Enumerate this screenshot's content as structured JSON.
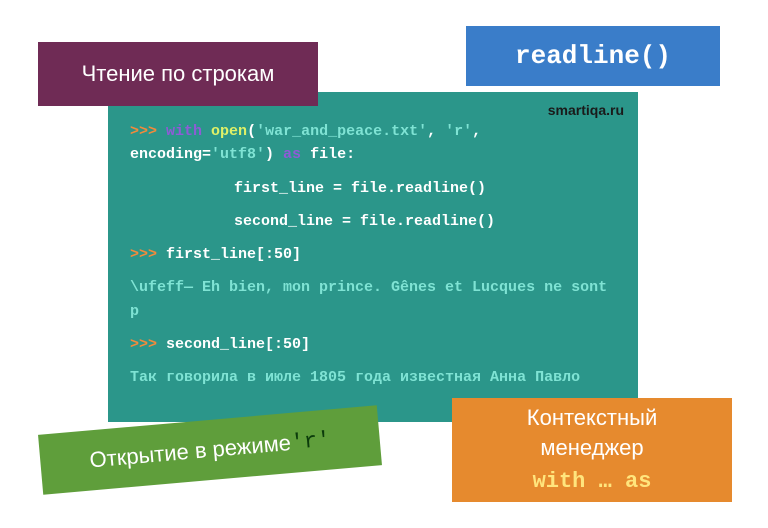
{
  "site": "smartiqa.ru",
  "labels": {
    "purple": "Чтение по строкам",
    "blue": "readline()",
    "green_text": "Открытие в режиме ",
    "green_code": "'r'",
    "orange_l1": "Контекстный",
    "orange_l2": "менеджер",
    "orange_code": "with … as"
  },
  "code": {
    "prompt": ">>> ",
    "kw_with": "with",
    "fn_open": "open",
    "paren_open": "(",
    "str_file": "'war_and_peace.txt'",
    "comma1": ", ",
    "str_mode": "'r'",
    "comma2": ", ",
    "enc_key": "encoding=",
    "str_enc": "'utf8'",
    "paren_close": ")",
    "kw_as": " as ",
    "varfile": "file:",
    "body1": "first_line = file.readline()",
    "body2": "second_line = file.readline()",
    "expr1": "first_line[:50]",
    "out1": "\\ufeff— Eh bien, mon prince. Gênes et Lucques ne sont p",
    "expr2": "second_line[:50]",
    "out2": "Так говорила в июле 1805 года известная Анна Павло"
  }
}
